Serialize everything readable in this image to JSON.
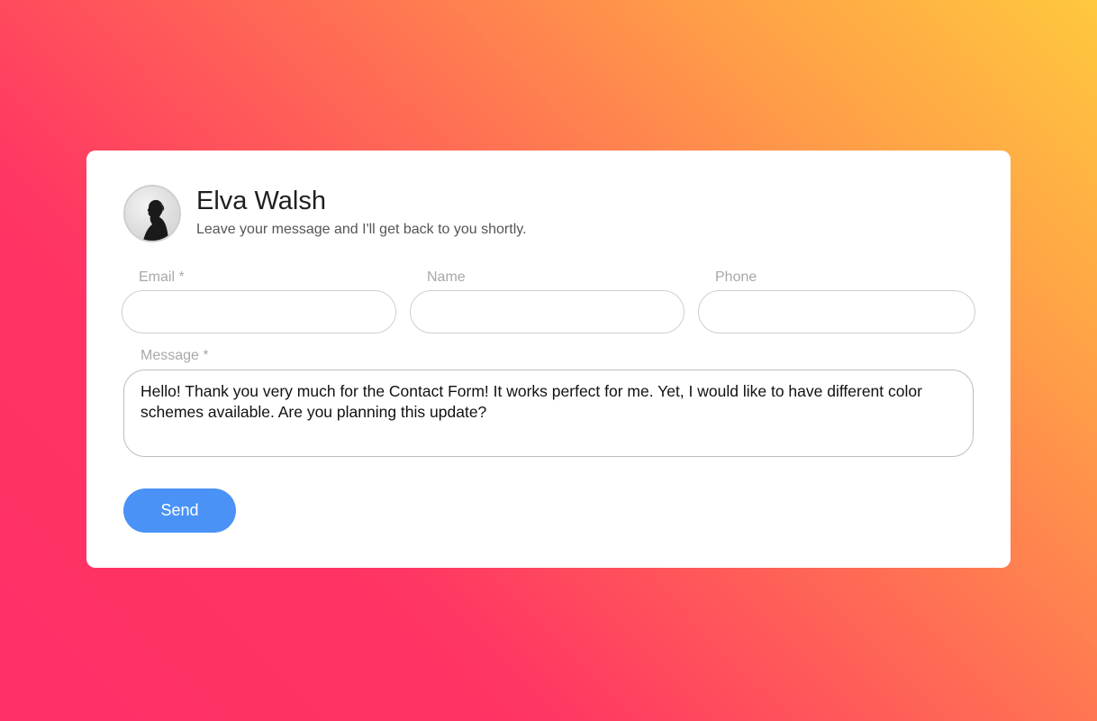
{
  "profile": {
    "name": "Elva Walsh",
    "tagline": "Leave your message and I'll get back to you shortly.",
    "avatar_icon": "person-silhouette-avatar"
  },
  "form": {
    "email": {
      "label": "Email *",
      "value": "",
      "placeholder": ""
    },
    "name": {
      "label": "Name",
      "value": "",
      "placeholder": ""
    },
    "phone": {
      "label": "Phone",
      "value": "",
      "placeholder": ""
    },
    "message": {
      "label": "Message *",
      "value": "Hello! Thank you very much for the Contact Form! It works perfect for me. Yet, I would like to have different color schemes available. Are you planning this update?"
    },
    "send_label": "Send"
  },
  "colors": {
    "gradient_top_right": "#ffc83e",
    "gradient_bottom_left": "#ff2f68",
    "button": "#4a92f5",
    "card": "#ffffff"
  }
}
